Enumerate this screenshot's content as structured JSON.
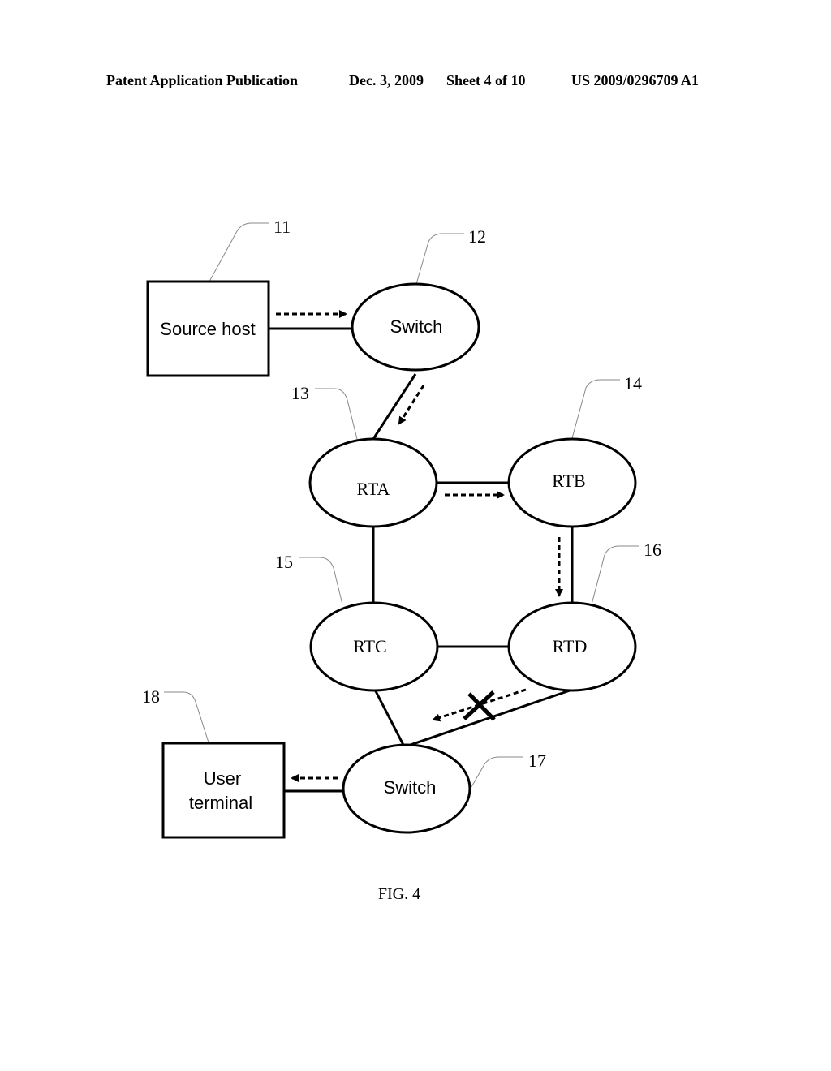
{
  "header": {
    "publication": "Patent Application Publication",
    "date": "Dec. 3, 2009",
    "sheet": "Sheet 4 of 10",
    "number": "US 2009/0296709 A1"
  },
  "diagram": {
    "nodes": {
      "source_host": {
        "label": "Source host",
        "ref": "11"
      },
      "switch_top": {
        "label": "Switch",
        "ref": "12"
      },
      "rta": {
        "label": "RTA",
        "ref": "13"
      },
      "rtb": {
        "label": "RTB",
        "ref": "14"
      },
      "rtc": {
        "label": "RTC",
        "ref": "15"
      },
      "rtd": {
        "label": "RTD",
        "ref": "16"
      },
      "switch_bottom": {
        "label": "Switch",
        "ref": "17"
      },
      "user_terminal": {
        "label_line1": "User",
        "label_line2": "terminal",
        "ref": "18"
      }
    },
    "links": [
      {
        "from": "source_host",
        "to": "switch_top",
        "flow": true
      },
      {
        "from": "switch_top",
        "to": "rta",
        "flow": true
      },
      {
        "from": "rta",
        "to": "rtb",
        "flow": true
      },
      {
        "from": "rta",
        "to": "rtc",
        "flow": false
      },
      {
        "from": "rtb",
        "to": "rtd",
        "flow": true
      },
      {
        "from": "rtc",
        "to": "rtd",
        "flow": false
      },
      {
        "from": "rtc",
        "to": "switch_bottom",
        "flow": false
      },
      {
        "from": "rtd",
        "to": "switch_bottom",
        "flow": true,
        "blocked": true
      },
      {
        "from": "switch_bottom",
        "to": "user_terminal",
        "flow": true
      }
    ]
  },
  "caption": "FIG. 4"
}
